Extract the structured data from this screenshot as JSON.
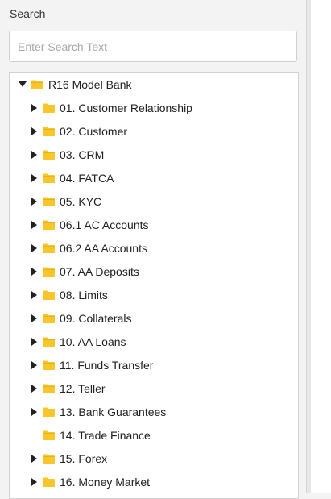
{
  "search": {
    "label": "Search",
    "placeholder": "Enter Search Text",
    "value": ""
  },
  "tree": {
    "root": {
      "label": "R16 Model Bank",
      "expanded": true,
      "icon": "folder-icon"
    },
    "children": [
      {
        "label": "01. Customer Relationship",
        "has_children": true
      },
      {
        "label": "02. Customer",
        "has_children": true
      },
      {
        "label": "03. CRM",
        "has_children": true
      },
      {
        "label": "04. FATCA",
        "has_children": true
      },
      {
        "label": "05. KYC",
        "has_children": true
      },
      {
        "label": "06.1 AC Accounts",
        "has_children": true
      },
      {
        "label": "06.2 AA Accounts",
        "has_children": true
      },
      {
        "label": "07. AA Deposits",
        "has_children": true
      },
      {
        "label": "08. Limits",
        "has_children": true
      },
      {
        "label": "09. Collaterals",
        "has_children": true
      },
      {
        "label": "10. AA Loans",
        "has_children": true
      },
      {
        "label": "11. Funds Transfer",
        "has_children": true
      },
      {
        "label": "12. Teller",
        "has_children": true
      },
      {
        "label": "13. Bank Guarantees",
        "has_children": true
      },
      {
        "label": "14. Trade Finance",
        "has_children": false
      },
      {
        "label": "15. Forex",
        "has_children": true
      },
      {
        "label": "16. Money Market",
        "has_children": true
      }
    ]
  },
  "colors": {
    "folder": "#f8c52b",
    "folder_tab": "#e9b21d",
    "arrow": "#222222"
  }
}
